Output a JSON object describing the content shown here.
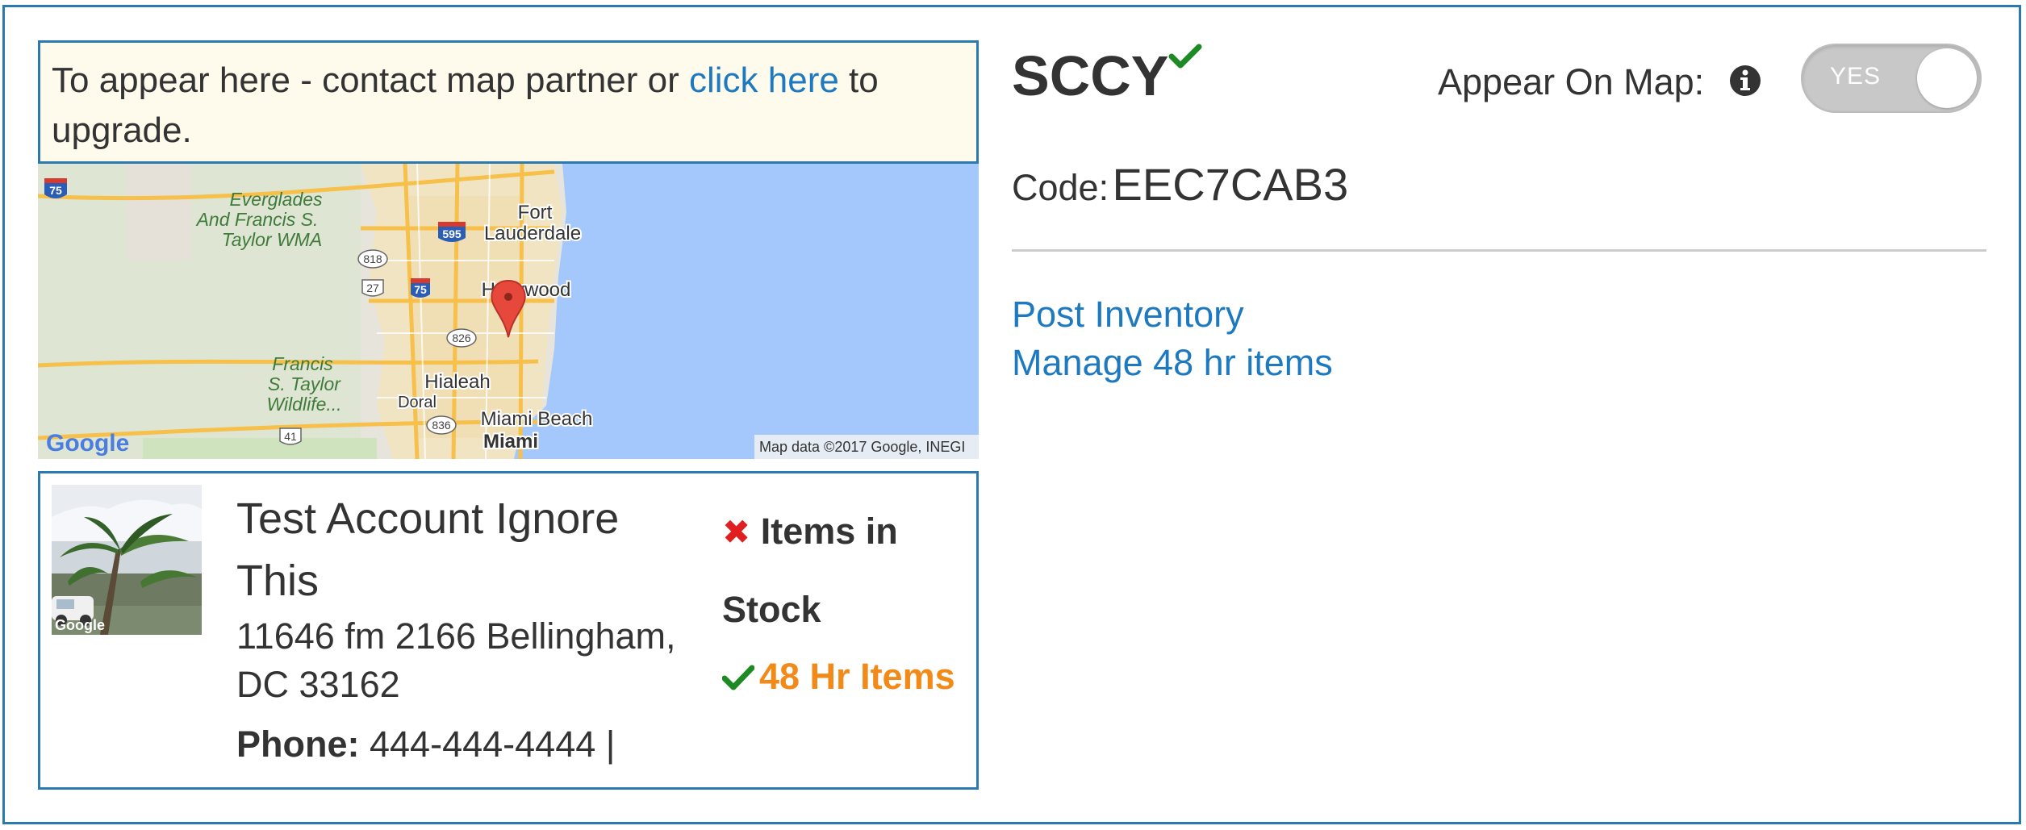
{
  "notice": {
    "prefix": "To appear here - contact map partner or ",
    "link": "click here",
    "suffix": " to upgrade."
  },
  "map": {
    "labels": {
      "everglades_1": "Everglades",
      "everglades_2": "And Francis S.",
      "everglades_3": "Taylor WMA",
      "fort_1": "Fort",
      "fort_2": "Lauderdale",
      "hollywood": "Hollywood",
      "francis_1": "Francis",
      "francis_2": "S. Taylor",
      "francis_3": "Wildlife...",
      "hialeah": "Hialeah",
      "doral": "Doral",
      "miami_beach": "Miami Beach",
      "miami": "Miami",
      "shield_75a": "75",
      "shield_595": "595",
      "shield_818": "818",
      "shield_27": "27",
      "shield_75b": "75",
      "shield_826": "826",
      "shield_836": "836",
      "shield_41": "41"
    },
    "logo": "Google",
    "attribution": "Map data ©2017 Google, INEGI",
    "colors": {
      "water": "#a4c8fb",
      "land": "#e8e6dc",
      "urban": "#f3e6c6",
      "road": "#f6c04a",
      "pin": "#e6483b"
    }
  },
  "card": {
    "thumb_logo": "Google",
    "name": "Test Account Ignore This",
    "address": "11646 fm 2166 Bellingham, DC 33162",
    "phone_label": "Phone:",
    "phone_value": " 444-444-4444 |",
    "stock_label": "Items in Stock",
    "hr_label": "48 Hr Items"
  },
  "header": {
    "title": "SCCY",
    "appear_label": "Appear On Map:",
    "toggle_text": "YES",
    "toggle_state": "on"
  },
  "code": {
    "label": "Code:",
    "value": "EEC7CAB3"
  },
  "links": {
    "post_inventory": "Post Inventory",
    "manage_48": "Manage 48 hr items"
  },
  "colors": {
    "accent": "#1e7ac0",
    "border": "#2a7ab0",
    "success": "#1e8a24",
    "error": "#e02020",
    "warning": "#f28a1a"
  }
}
